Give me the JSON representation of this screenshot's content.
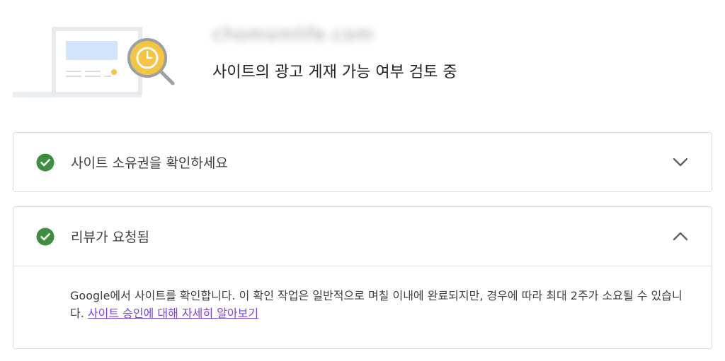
{
  "header": {
    "site_url": "chomsmlife.com",
    "status_title": "사이트의 광고 게재 가능 여부 검토 중"
  },
  "steps": [
    {
      "title": "사이트 소유권을 확인하세요",
      "status_icon": "check-circle-icon",
      "toggle_icon": "chevron-down-icon",
      "expanded": false
    },
    {
      "title": "리뷰가 요청됨",
      "status_icon": "check-circle-icon",
      "toggle_icon": "chevron-up-icon",
      "expanded": true,
      "body_text": "Google에서 사이트를 확인합니다. 이 확인 작업은 일반적으로 며칠 이내에 완료되지만, 경우에 따라 최대 2주가 소요될 수 있습니다.",
      "link_text": "사이트 승인에 대해 자세히 알아보기"
    }
  ],
  "colors": {
    "success_green": "#3e8e41",
    "link_purple": "#7b45d6",
    "border": "#dadce0",
    "illustration_blue": "#d2e3fc",
    "illustration_yellow": "#f4c542"
  }
}
